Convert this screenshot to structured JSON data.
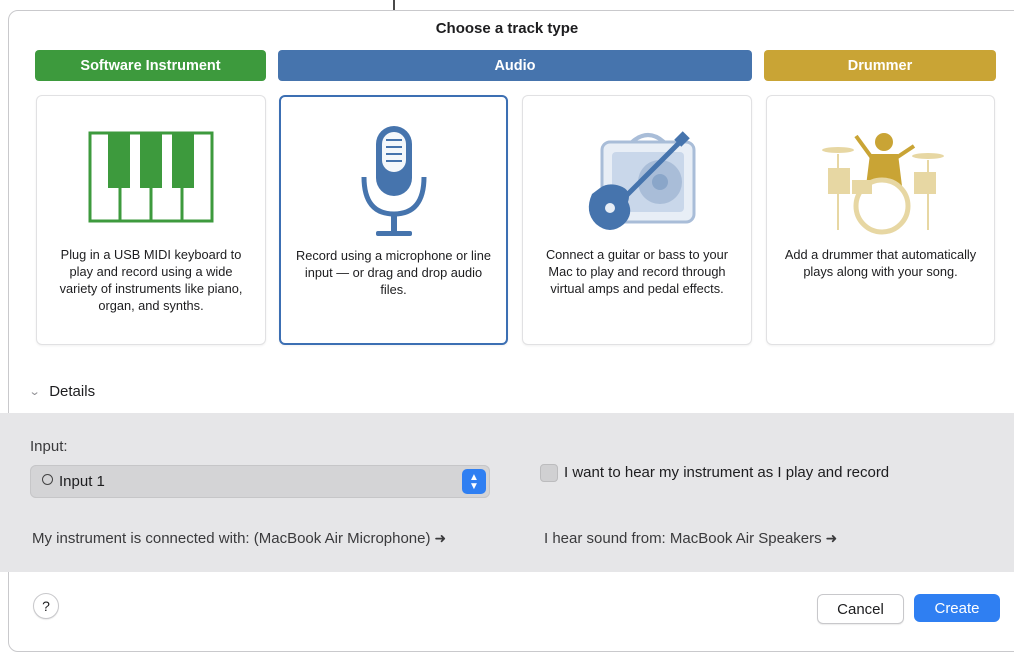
{
  "dialog": {
    "title": "Choose a track type"
  },
  "categories": [
    {
      "label": "Software Instrument",
      "color": "#3d9a3d"
    },
    {
      "label": "Audio",
      "color": "#4674ad"
    },
    {
      "label": "Drummer",
      "color": "#c9a435"
    }
  ],
  "cards": [
    {
      "description": "Plug in a USB MIDI keyboard to play and record using a wide variety of instruments like piano, organ, and synths.",
      "icon": "piano-keyboard-icon"
    },
    {
      "description": "Record using a microphone or line input — or drag and drop audio files.",
      "icon": "microphone-icon",
      "selected": true
    },
    {
      "description": "Connect a guitar or bass to your Mac to play and record through virtual amps and pedal effects.",
      "icon": "guitar-amp-icon"
    },
    {
      "description": "Add a drummer that automatically plays along with your song.",
      "icon": "drummer-icon"
    }
  ],
  "details": {
    "toggle_label": "Details",
    "input_label": "Input:",
    "input_value": "Input 1",
    "monitor_label": "I want to hear my instrument as I play and record",
    "connected_text": "My instrument is connected with: (MacBook Air Microphone)",
    "output_text": "I hear sound from: MacBook Air Speakers"
  },
  "footer": {
    "help_label": "?",
    "cancel_label": "Cancel",
    "create_label": "Create"
  },
  "colors": {
    "accent": "#2f7ff2",
    "selected_border": "#3c6fb3",
    "instrument_green": "#3d9a3d",
    "audio_blue": "#4674ad",
    "drummer_gold": "#c9a435"
  }
}
